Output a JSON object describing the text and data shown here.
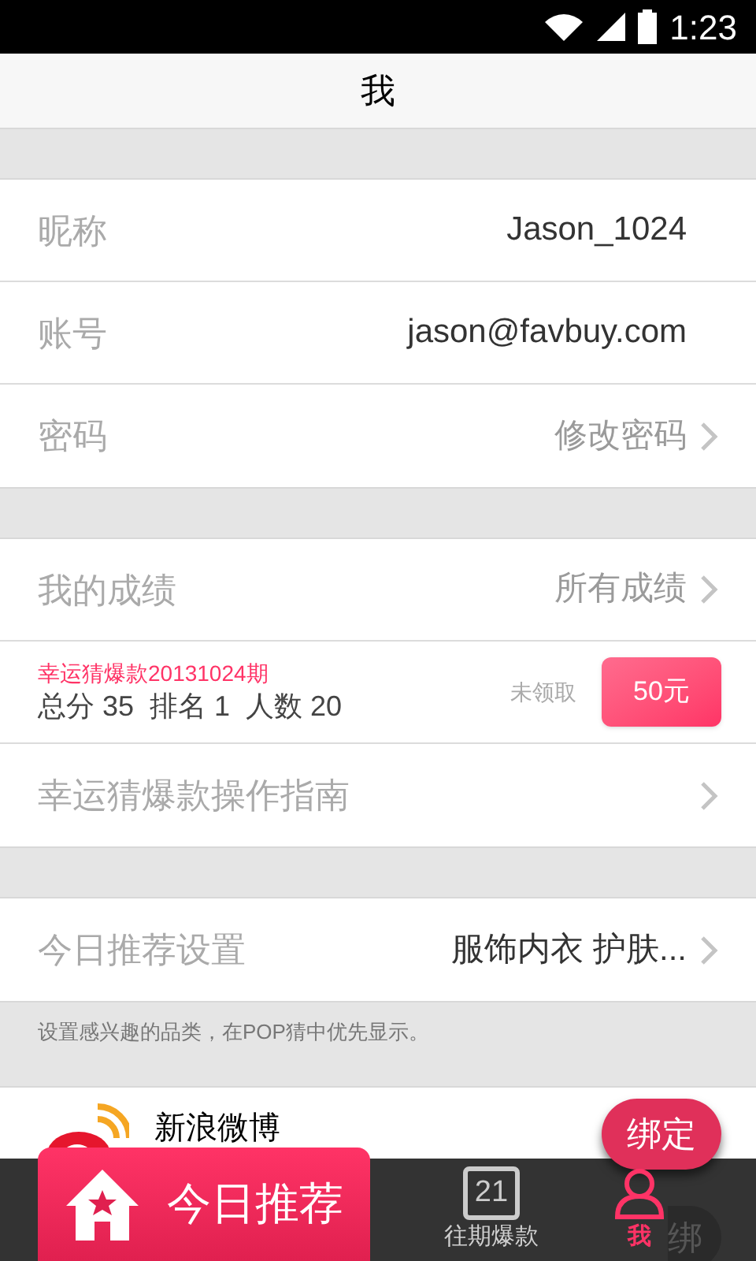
{
  "status_bar": {
    "time": "1:23"
  },
  "title": "我",
  "sections": [
    {
      "rows": [
        {
          "kind": "field",
          "label": "昵称",
          "value": "Jason_1024",
          "muted": false,
          "chevron": false
        },
        {
          "kind": "field",
          "label": "账号",
          "value": "jason@favbuy.com",
          "muted": false,
          "chevron": false
        },
        {
          "kind": "field",
          "label": "密码",
          "value": "修改密码",
          "muted": true,
          "chevron": true
        }
      ]
    },
    {
      "rows": [
        {
          "kind": "field",
          "label": "我的成绩",
          "value": "所有成绩",
          "muted": true,
          "chevron": true
        },
        {
          "kind": "record",
          "title": "幸运猜爆款20131024期",
          "stats": "总分 35  排名 1  人数 20",
          "status": "未领取",
          "prize": "50元"
        },
        {
          "kind": "field",
          "label": "幸运猜爆款操作指南",
          "chevron": true
        }
      ]
    },
    {
      "rows": [
        {
          "kind": "field",
          "label": "今日推荐设置",
          "value": "服饰内衣 护肤...",
          "muted": false,
          "chevron": true
        }
      ],
      "note": "设置感兴趣的品类，在POP猜中优先显示。"
    }
  ],
  "weibo": {
    "name": "新浪微博",
    "button": "绑定",
    "hidden_button": "绑"
  },
  "tabs": [
    {
      "kind": "featured",
      "label": "今日推荐",
      "selected": false
    },
    {
      "kind": "calendar",
      "label": "往期爆款",
      "day": "21",
      "selected": false
    },
    {
      "kind": "person",
      "label": "我",
      "selected": true
    }
  ]
}
